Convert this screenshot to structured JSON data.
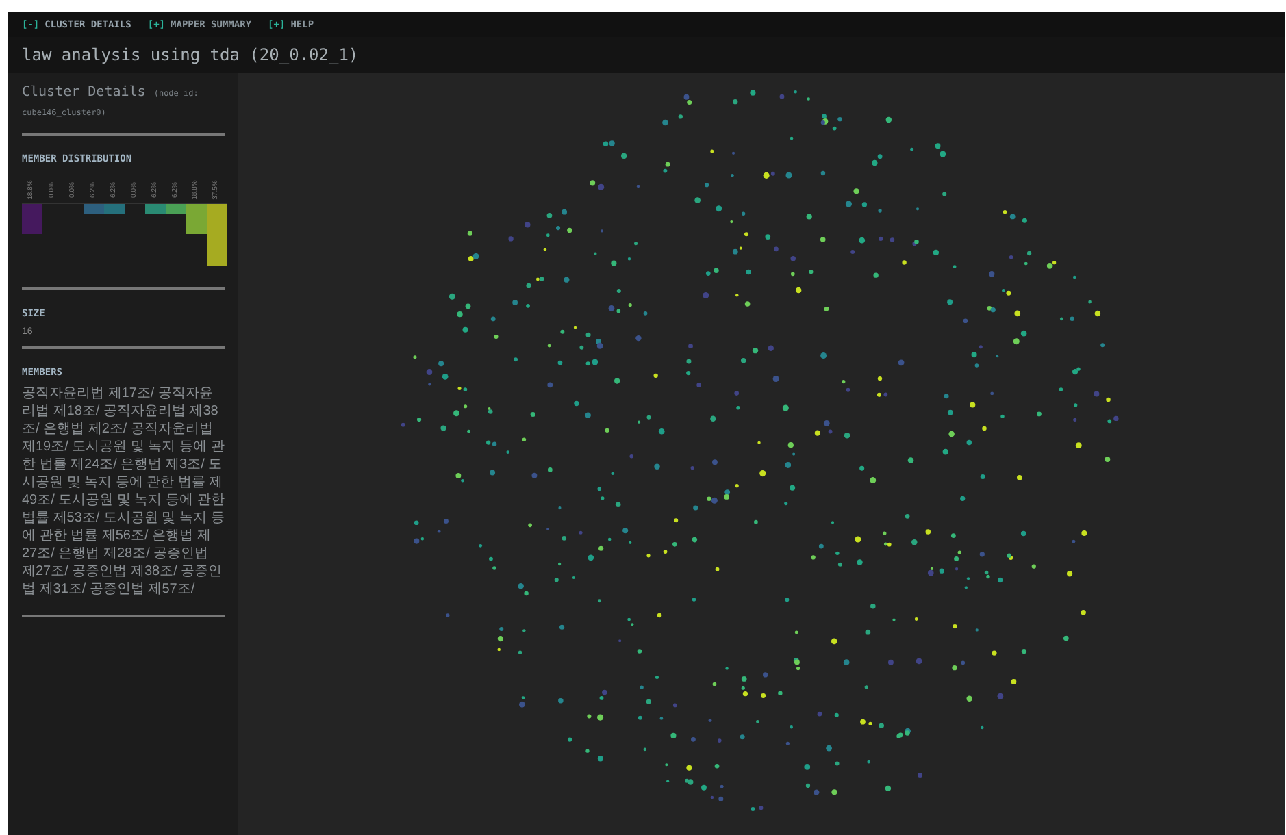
{
  "menu": [
    {
      "toggle": "[-]",
      "label": "CLUSTER DETAILS",
      "expanded": true
    },
    {
      "toggle": "[+]",
      "label": "MAPPER SUMMARY",
      "expanded": false
    },
    {
      "toggle": "[+]",
      "label": "HELP",
      "expanded": false
    }
  ],
  "title": "law analysis using tda (20_0.02_1)",
  "sidebar": {
    "heading": "Cluster Details",
    "node_id": "(node id: cube146_cluster0)",
    "distribution": {
      "title": "MEMBER DISTRIBUTION",
      "bins": [
        {
          "label": "18.8%"
        },
        {
          "label": "0.0%"
        },
        {
          "label": "0.0%"
        },
        {
          "label": "6.2%"
        },
        {
          "label": "6.2%"
        },
        {
          "label": "0.0%"
        },
        {
          "label": "6.2%"
        },
        {
          "label": "6.2%"
        },
        {
          "label": "18.8%"
        },
        {
          "label": "37.5%"
        }
      ]
    },
    "size": {
      "title": "SIZE",
      "value": "16"
    },
    "members": {
      "title": "MEMBERS",
      "text": "공직자윤리법 제17조/ 공직자윤리법 제18조/ 공직자윤리법 제38조/ 은행법 제2조/ 공직자윤리법 제19조/ 도시공원 및 녹지 등에 관한 법률 제24조/ 은행법 제3조/ 도시공원 및 녹지 등에 관한 법률 제49조/ 도시공원 및 녹지 등에 관한 법률 제53조/ 도시공원 및 녹지 등에 관한 법률 제56조/ 은행법 제27조/ 은행법 제28조/ 공증인법 제27조/ 공증인법 제38조/ 공증인법 제31조/ 공증인법 제57조/"
    }
  }
}
